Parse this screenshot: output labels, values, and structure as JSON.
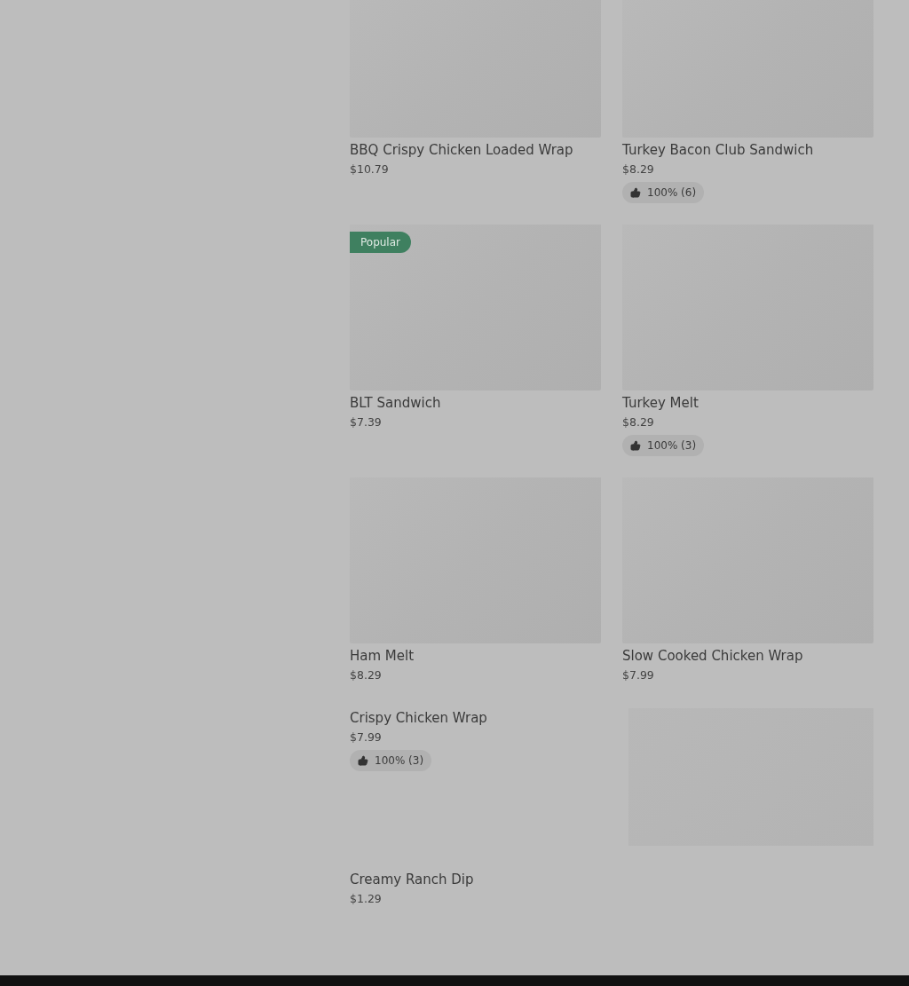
{
  "menu_items": [
    {
      "kind": "tile",
      "name": "BBQ Crispy Chicken Loaded Wrap",
      "price": "$10.79"
    },
    {
      "kind": "tile",
      "name": "Turkey Bacon Club Sandwich",
      "price": "$8.29",
      "rating": "100% (6)"
    },
    {
      "kind": "tile",
      "name": "BLT Sandwich",
      "price": "$7.39",
      "badge": "Popular"
    },
    {
      "kind": "tile",
      "name": "Turkey Melt",
      "price": "$8.29",
      "rating": "100% (3)"
    },
    {
      "kind": "tile",
      "name": "Ham Melt",
      "price": "$8.29"
    },
    {
      "kind": "tile",
      "name": "Slow Cooked Chicken Wrap",
      "price": "$7.99"
    },
    {
      "kind": "side_image",
      "name": "Crispy Chicken Wrap",
      "price": "$7.99",
      "rating": "100% (3)"
    },
    {
      "kind": "plain",
      "name": "Creamy Ranch Dip",
      "price": "$1.29"
    }
  ]
}
